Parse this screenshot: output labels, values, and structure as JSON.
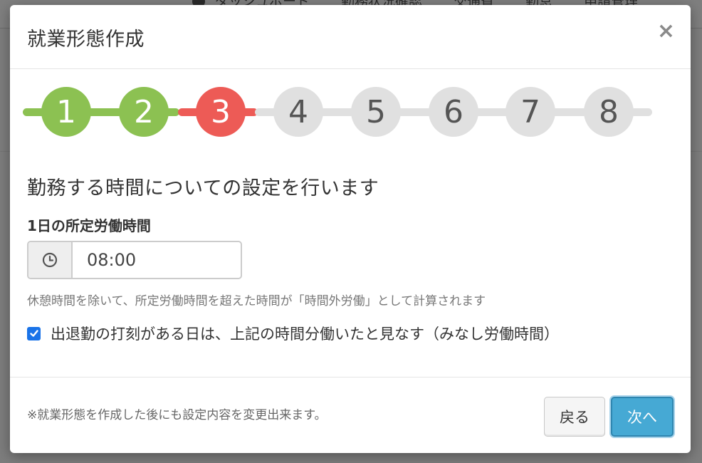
{
  "background_nav": {
    "items": [
      "ダッシュボード",
      "勤務状況確認",
      "交通費",
      "勤怠",
      "申請管理"
    ]
  },
  "modal": {
    "title": "就業形態作成",
    "close_label": "×",
    "stepper": {
      "steps": [
        "1",
        "2",
        "3",
        "4",
        "5",
        "6",
        "7",
        "8"
      ],
      "current_step": 3,
      "colors": {
        "done": "#8cc152",
        "active": "#ed5b56",
        "pending": "#e0e0e0"
      }
    },
    "section_heading": "勤務する時間についての設定を行います",
    "work_hours": {
      "label": "1日の所定労働時間",
      "value": "08:00",
      "icon": "clock-icon",
      "help_text": "休憩時間を除いて、所定労働時間を超えた時間が「時間外労働」として計算されます"
    },
    "deemed_hours": {
      "checked": true,
      "label": "出退勤の打刻がある日は、上記の時間分働いたと見なす（みなし労働時間）"
    },
    "footer": {
      "note": "※就業形態を作成した後にも設定内容を変更出来ます。",
      "back_label": "戻る",
      "next_label": "次へ"
    }
  }
}
